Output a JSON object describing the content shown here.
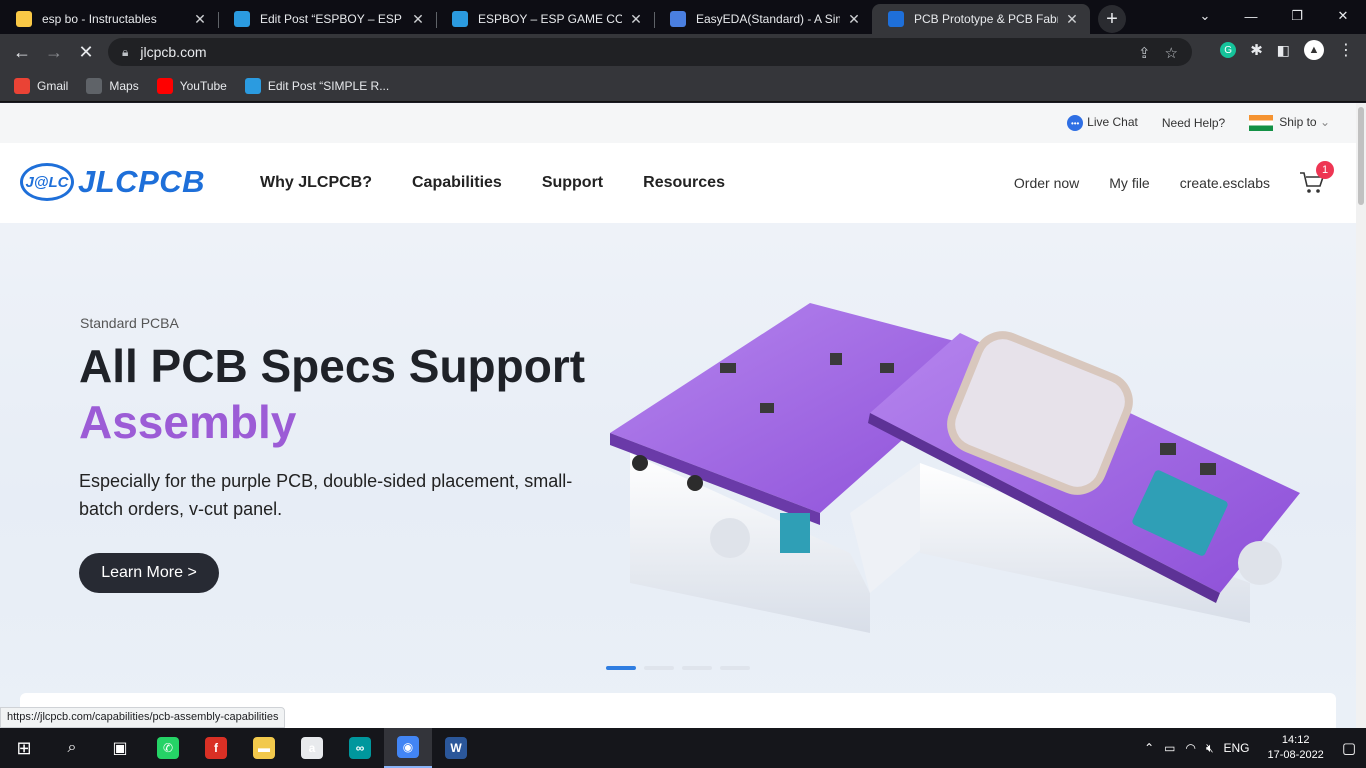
{
  "browser": {
    "tabs": [
      {
        "title": "esp bo - Instructables",
        "icon": "instructables-icon",
        "color": "#f9c846",
        "active": false
      },
      {
        "title": "Edit Post “ESPBOY – ESP GAM",
        "icon": "wordpress-icon",
        "color": "#2b9be0",
        "active": false
      },
      {
        "title": "ESPBOY – ESP GAME CONTR",
        "icon": "wordpress-icon",
        "color": "#2b9be0",
        "active": false
      },
      {
        "title": "EasyEDA(Standard) - A Simpl",
        "icon": "easyeda-icon",
        "color": "#4a7fe0",
        "active": false
      },
      {
        "title": "PCB Prototype & PCB Fabrica",
        "icon": "jlcpcb-icon",
        "color": "#1e6fd9",
        "active": true
      }
    ],
    "url": "jlcpcb.com",
    "bookmarks": [
      {
        "label": "Gmail",
        "icon": "gmail-icon",
        "color": "#ea4335"
      },
      {
        "label": "Maps",
        "icon": "maps-icon",
        "color": "#5f6368"
      },
      {
        "label": "YouTube",
        "icon": "youtube-icon",
        "color": "#ff0000"
      },
      {
        "label": "Edit Post “SIMPLE R...",
        "icon": "wordpress-icon",
        "color": "#2b9be0"
      }
    ],
    "status_url": "https://jlcpcb.com/capabilities/pcb-assembly-capabilities"
  },
  "site": {
    "utility": {
      "live_chat": "Live Chat",
      "need_help": "Need Help?",
      "ship_to": "Ship to"
    },
    "logo": {
      "badge": "J@LC",
      "word": "JLCPCB"
    },
    "nav": [
      "Why JLCPCB?",
      "Capabilities",
      "Support",
      "Resources"
    ],
    "nav_right": [
      "Order now",
      "My file",
      "create.esclabs"
    ],
    "cart_count": "1",
    "hero": {
      "subtitle": "Standard PCBA",
      "title_line1": "All PCB Specs Support",
      "title_line2": "Assembly",
      "description": "Especially for the purple PCB, double-sided placement, small-batch orders, v-cut panel.",
      "cta": "Learn More >",
      "slide_count": 4,
      "active_slide": 1
    }
  },
  "taskbar": {
    "apps": [
      {
        "name": "whatsapp-icon",
        "glyph": "✆",
        "color": "#25d366"
      },
      {
        "name": "foxit-icon",
        "glyph": "f",
        "color": "#d93025"
      },
      {
        "name": "file-explorer-icon",
        "glyph": "▬",
        "color": "#f2c94c"
      },
      {
        "name": "app-a-icon",
        "glyph": "a",
        "color": "#e8eaed"
      },
      {
        "name": "arduino-icon",
        "glyph": "∞",
        "color": "#00979d"
      },
      {
        "name": "chrome-icon",
        "glyph": "◉",
        "color": "#4285f4"
      },
      {
        "name": "word-icon",
        "glyph": "W",
        "color": "#2b579a"
      }
    ],
    "language": "ENG",
    "time": "14:12",
    "date": "17-08-2022"
  },
  "colors": {
    "brand_blue": "#1e6fd9",
    "purple": "#9c5cd6",
    "badge_red": "#ee3553"
  }
}
